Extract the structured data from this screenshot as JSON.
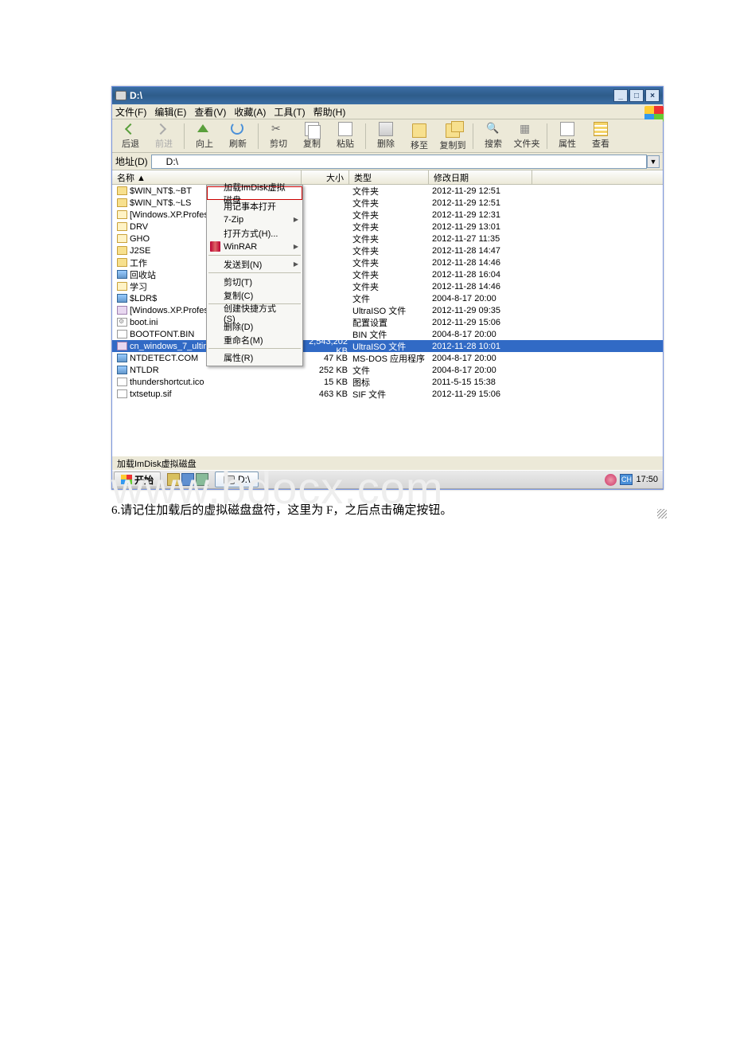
{
  "titlebar": {
    "title": "D:\\"
  },
  "menubar": {
    "file": "文件(F)",
    "edit": "编辑(E)",
    "view": "查看(V)",
    "fav": "收藏(A)",
    "tools": "工具(T)",
    "help": "帮助(H)"
  },
  "toolbar": {
    "back": "后退",
    "forward": "前进",
    "up": "向上",
    "refresh": "刷新",
    "cut": "剪切",
    "copy": "复制",
    "paste": "粘贴",
    "delete": "删除",
    "moveto": "移至",
    "copyto": "复制到",
    "search": "搜索",
    "folders": "文件夹",
    "props": "属性",
    "view": "查看"
  },
  "addressbar": {
    "label": "地址(D)",
    "value": "D:\\"
  },
  "headers": {
    "name": "名称 ▲",
    "size": "大小",
    "type": "类型",
    "date": "修改日期"
  },
  "files": [
    {
      "ic": "folder",
      "name": "$WIN_NT$.~BT",
      "size": "",
      "type": "文件夹",
      "date": "2012-11-29 12:51"
    },
    {
      "ic": "folder",
      "name": "$WIN_NT$.~LS",
      "size": "",
      "type": "文件夹",
      "date": "2012-11-29 12:51"
    },
    {
      "ic": "folder-o",
      "name": "[Windows.XP.Profess",
      "size": "",
      "type": "文件夹",
      "date": "2012-11-29 12:31"
    },
    {
      "ic": "folder-o",
      "name": "DRV",
      "size": "",
      "type": "文件夹",
      "date": "2012-11-29 13:01"
    },
    {
      "ic": "folder-o",
      "name": "GHO",
      "size": "",
      "type": "文件夹",
      "date": "2012-11-27 11:35"
    },
    {
      "ic": "folder",
      "name": "J2SE",
      "size": "",
      "type": "文件夹",
      "date": "2012-11-28 14:47"
    },
    {
      "ic": "folder",
      "name": "工作",
      "size": "",
      "type": "文件夹",
      "date": "2012-11-28 14:46"
    },
    {
      "ic": "sys",
      "name": "回收站",
      "size": "",
      "type": "文件夹",
      "date": "2012-11-28 16:04"
    },
    {
      "ic": "folder-o",
      "name": "学习",
      "size": "",
      "type": "文件夹",
      "date": "2012-11-28 14:46"
    },
    {
      "ic": "sys",
      "name": "$LDR$",
      "size": "",
      "type": "文件",
      "date": "2004-8-17 20:00"
    },
    {
      "ic": "iso",
      "name": "[Windows.XP.Profess",
      "size": "",
      "type": "UltraISO 文件",
      "date": "2012-11-29 09:35"
    },
    {
      "ic": "ini",
      "name": "boot.ini",
      "size": "",
      "type": "配置设置",
      "date": "2012-11-29 15:06"
    },
    {
      "ic": "file",
      "name": "BOOTFONT.BIN",
      "size": "",
      "type": "BIN 文件",
      "date": "2004-8-17 20:00"
    },
    {
      "ic": "iso",
      "name": "cn_windows_7_ultimate_x86_...",
      "size": "2,543,202 KB",
      "type": "UltraISO 文件",
      "date": "2012-11-28 10:01",
      "sel": true
    },
    {
      "ic": "sys",
      "name": "NTDETECT.COM",
      "size": "47 KB",
      "type": "MS-DOS 应用程序",
      "date": "2004-8-17 20:00"
    },
    {
      "ic": "sys",
      "name": "NTLDR",
      "size": "252 KB",
      "type": "文件",
      "date": "2004-8-17 20:00"
    },
    {
      "ic": "file",
      "name": "thundershortcut.ico",
      "size": "15 KB",
      "type": "图标",
      "date": "2011-5-15 15:38"
    },
    {
      "ic": "file",
      "name": "txtsetup.sif",
      "size": "463 KB",
      "type": "SIF 文件",
      "date": "2012-11-29 15:06"
    }
  ],
  "contextmenu": {
    "mount": "加载ImDisk虚拟磁盘",
    "notepad": "用记事本打开",
    "sevenzip": "7-Zip",
    "openwith": "打开方式(H)...",
    "winrar": "WinRAR",
    "sendto": "发送到(N)",
    "cut": "剪切(T)",
    "copy": "复制(C)",
    "shortcut": "创建快捷方式(S)",
    "delete": "删除(D)",
    "rename": "重命名(M)",
    "props": "属性(R)"
  },
  "statusbar": {
    "text": "加载ImDisk虚拟磁盘"
  },
  "taskbar": {
    "start": "开始",
    "task1": "D:\\",
    "lang": "CH",
    "time": "17:50"
  },
  "caption": "6.请记住加载后的虚拟磁盘盘符，这里为 F，之后点击确定按钮。",
  "watermark": "www.bdocx.com",
  "chart_data": null
}
